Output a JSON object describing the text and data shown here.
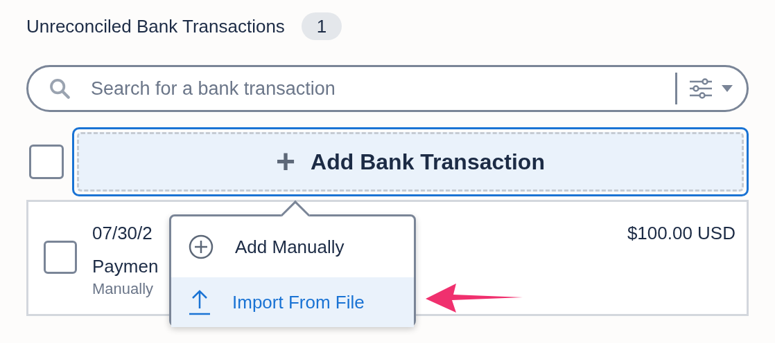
{
  "header": {
    "title": "Unreconciled Bank Transactions",
    "count": "1"
  },
  "search": {
    "placeholder": "Search for a bank transaction"
  },
  "select_all": {
    "checked": false
  },
  "add_button": {
    "icon": "+",
    "label": "Add Bank Transaction"
  },
  "transactions": [
    {
      "checked": false,
      "date": "07/30/2",
      "description": "Paymen",
      "source": "Manually",
      "amount": "$100.00 USD"
    }
  ],
  "menu": {
    "items": [
      {
        "kind": "add",
        "label": "Add Manually",
        "selected": false
      },
      {
        "kind": "import",
        "label": "Import From File",
        "selected": true
      }
    ]
  }
}
